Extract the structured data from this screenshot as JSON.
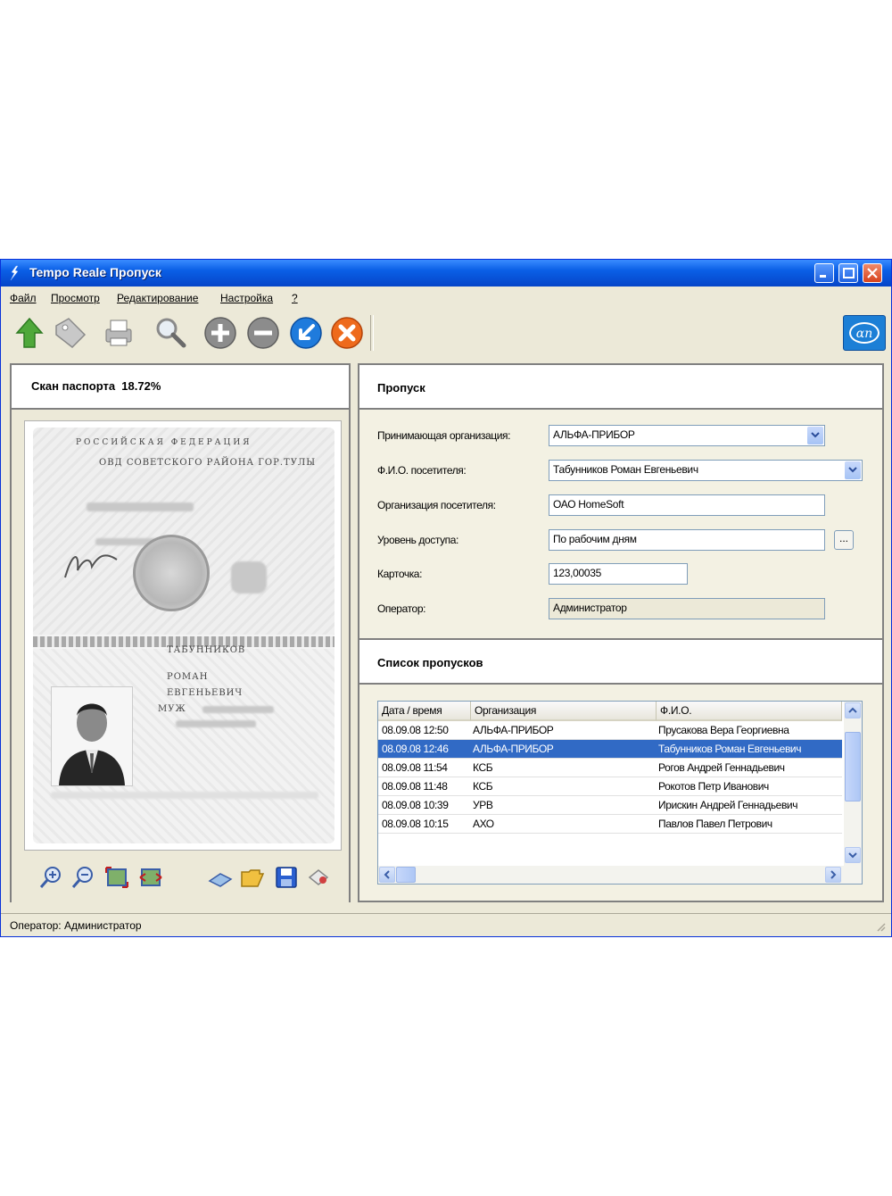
{
  "window": {
    "title": "Tempo Reale Пропуск"
  },
  "menu": [
    "Файл",
    "Просмотр",
    "Редактирование",
    "Настройка",
    "?"
  ],
  "toolbar": {
    "icons": [
      "arrow-up-icon",
      "tag-icon",
      "printer-icon",
      "search-icon",
      "add-icon",
      "remove-icon",
      "confirm-icon",
      "cancel-icon"
    ],
    "logo_text": "αn"
  },
  "scan_panel": {
    "title": "Скан паспорта",
    "zoom": "18.72%",
    "tools": [
      "zoom-in-icon",
      "zoom-out-icon",
      "fit-page-icon",
      "fit-width-icon",
      "scanner-icon",
      "open-folder-icon",
      "save-icon",
      "erase-icon"
    ]
  },
  "pass_panel": {
    "title": "Пропуск",
    "fields": {
      "org_label": "Принимающая организация:",
      "org_value": "АЛЬФА-ПРИБОР",
      "fio_label": "Ф.И.О. посетителя:",
      "fio_value": "Табунников Роман Евгеньевич",
      "visitor_org_label": "Организация посетителя:",
      "visitor_org_value": "ОАО HomeSoft",
      "access_label": "Уровень доступа:",
      "access_value": "По рабочим дням",
      "access_btn": "...",
      "card_label": "Карточка:",
      "card_value": "123,00035",
      "operator_label": "Оператор:",
      "operator_value": "Администратор"
    }
  },
  "list_panel": {
    "title": "Список пропусков",
    "columns": [
      "Дата / время",
      "Организация",
      "Ф.И.О."
    ],
    "rows": [
      {
        "date": "08.09.08 12:50",
        "org": "АЛЬФА-ПРИБОР",
        "fio": "Прусакова Вера Георгиевна"
      },
      {
        "date": "08.09.08 12:46",
        "org": "АЛЬФА-ПРИБОР",
        "fio": "Табунников Роман Евгеньевич"
      },
      {
        "date": "08.09.08 11:54",
        "org": "КСБ",
        "fio": "Рогов Андрей Геннадьевич"
      },
      {
        "date": "08.09.08 11:48",
        "org": "КСБ",
        "fio": "Рокотов Петр Иванович"
      },
      {
        "date": "08.09.08 10:39",
        "org": "УРВ",
        "fio": "Ирискин Андрей Геннадьевич"
      },
      {
        "date": "08.09.08 10:15",
        "org": "АХО",
        "fio": "Павлов Павел Петрович"
      }
    ],
    "selected_row": 1
  },
  "passport_scan": {
    "header": "РОССИЙСКАЯ ФЕДЕРАЦИЯ",
    "issued_by": "ОВД СОВЕТСКОГО РАЙОНА ГОР.ТУЛЫ",
    "surname": "ТАБУННИКОВ",
    "name": "РОМАН",
    "patronymic": "ЕВГЕНЬЕВИЧ",
    "sex": "МУЖ"
  },
  "statusbar": {
    "text": "Оператор: Администратор"
  },
  "colors": {
    "titlebar": "#0a5fe6",
    "selection": "#316ac5",
    "panel": "#f3f1e3",
    "frame": "#808080"
  }
}
